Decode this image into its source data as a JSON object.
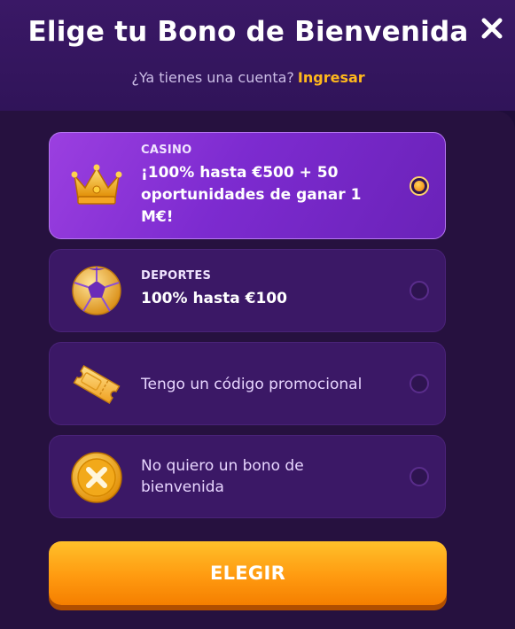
{
  "header": {
    "title": "Elige tu Bono de Bienvenida",
    "question": "¿Ya tienes una cuenta?",
    "login_link": "Ingresar",
    "close_icon": "close-icon"
  },
  "options": [
    {
      "category": "CASINO",
      "text": "¡100% hasta €500 + 50 oportunidades de ganar 1 M€!",
      "icon": "crown-icon",
      "selected": true
    },
    {
      "category": "DEPORTES",
      "text": "100% hasta €100",
      "icon": "soccer-ball-icon",
      "selected": false
    },
    {
      "text": "Tengo un código promocional",
      "icon": "ticket-icon",
      "selected": false
    },
    {
      "text": "No quiero un bono de bienvenida",
      "icon": "x-coin-icon",
      "selected": false
    }
  ],
  "cta": {
    "label": "ELEGIR"
  },
  "colors": {
    "accent": "#ffb81c",
    "selected_card": "#8a34d6",
    "card": "#3b1866",
    "button": "#ff9a10"
  }
}
